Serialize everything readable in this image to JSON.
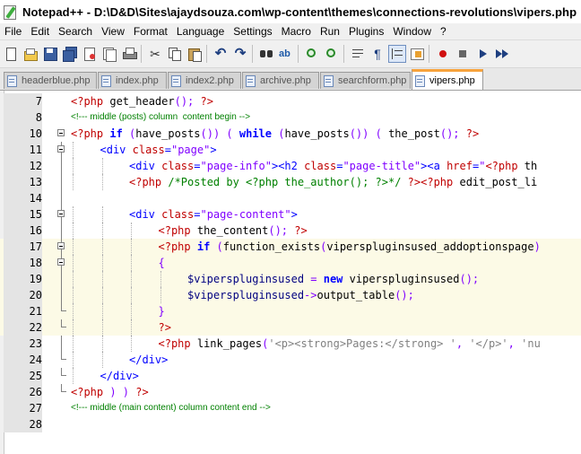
{
  "window": {
    "title": "Notepad++ - D:\\D&D\\Sites\\ajaydsouza.com\\wp-content\\themes\\connections-revolutions\\vipers.php"
  },
  "menu": [
    "File",
    "Edit",
    "Search",
    "View",
    "Format",
    "Language",
    "Settings",
    "Macro",
    "Run",
    "Plugins",
    "Window",
    "?"
  ],
  "toolbar": {
    "buttons": [
      "new-icon",
      "open-icon",
      "save-icon",
      "save-all-icon",
      "close-icon",
      "close-all-icon",
      "print-icon",
      "cut-icon",
      "copy-icon",
      "paste-icon",
      "undo-icon",
      "redo-icon",
      "find-icon",
      "replace-icon",
      "zoom-in-icon",
      "zoom-out-icon",
      "wrap-icon",
      "show-all-icon",
      "indent-guide-icon",
      "lang-icon",
      "record-icon",
      "stop-icon",
      "play-icon",
      "run-multi-icon"
    ],
    "active": "lang-icon"
  },
  "tabs": [
    {
      "label": "headerblue.php",
      "active": false
    },
    {
      "label": "index.php",
      "active": false
    },
    {
      "label": "index2.php",
      "active": false
    },
    {
      "label": "archive.php",
      "active": false
    },
    {
      "label": "searchform.php",
      "active": false
    },
    {
      "label": "vipers.php",
      "active": true
    }
  ],
  "editor": {
    "lines": [
      {
        "n": "7",
        "fold": "",
        "indent": 0,
        "hl": false,
        "tokens": [
          [
            "php",
            "<?php "
          ],
          [
            "fn",
            "get_header"
          ],
          [
            "op",
            "(); "
          ],
          [
            "php",
            "?>"
          ]
        ]
      },
      {
        "n": "8",
        "fold": "",
        "indent": 0,
        "hl": false,
        "small": true,
        "tokens": [
          [
            "com",
            "<!--- middle (posts) column  content begin -->"
          ]
        ]
      },
      {
        "n": "10",
        "fold": "box",
        "indent": 0,
        "hl": false,
        "tokens": [
          [
            "php",
            "<?php "
          ],
          [
            "kw",
            "if"
          ],
          [
            "op",
            " ("
          ],
          [
            "fn",
            "have_posts"
          ],
          [
            "op",
            "()) ( "
          ],
          [
            "kw",
            "while"
          ],
          [
            "op",
            " ("
          ],
          [
            "fn",
            "have_posts"
          ],
          [
            "op",
            "()) ( "
          ],
          [
            "fn",
            "the_post"
          ],
          [
            "op",
            "(); "
          ],
          [
            "php",
            "?>"
          ]
        ]
      },
      {
        "n": "11",
        "fold": "box",
        "indent": 1,
        "hl": false,
        "tokens": [
          [
            "tag",
            "<div "
          ],
          [
            "attr",
            "class"
          ],
          [
            "tag",
            "="
          ],
          [
            "str",
            "\"page\""
          ],
          [
            "tag",
            ">"
          ]
        ]
      },
      {
        "n": "12",
        "fold": "line",
        "indent": 2,
        "hl": false,
        "tokens": [
          [
            "tag",
            "<div "
          ],
          [
            "attr",
            "class"
          ],
          [
            "tag",
            "="
          ],
          [
            "str",
            "\"page-info\""
          ],
          [
            "tag",
            "><h2 "
          ],
          [
            "attr",
            "class"
          ],
          [
            "tag",
            "="
          ],
          [
            "str",
            "\"page-title\""
          ],
          [
            "tag",
            "><a "
          ],
          [
            "attr",
            "href"
          ],
          [
            "tag",
            "="
          ],
          [
            "str",
            "\""
          ],
          [
            "php",
            "<?php "
          ],
          [
            "fn",
            "th"
          ]
        ]
      },
      {
        "n": "13",
        "fold": "line",
        "indent": 2,
        "hl": false,
        "tokens": [
          [
            "php",
            "<?php "
          ],
          [
            "com",
            "/*Posted by <?php the_author(); ?>*/ "
          ],
          [
            "php",
            "?><?php "
          ],
          [
            "fn",
            "edit_post_li"
          ]
        ]
      },
      {
        "n": "14",
        "fold": "line",
        "indent": 0,
        "hl": false,
        "tokens": []
      },
      {
        "n": "15",
        "fold": "box",
        "indent": 2,
        "hl": false,
        "tokens": [
          [
            "tag",
            "<div "
          ],
          [
            "attr",
            "class"
          ],
          [
            "tag",
            "="
          ],
          [
            "str",
            "\"page-content\""
          ],
          [
            "tag",
            ">"
          ]
        ]
      },
      {
        "n": "16",
        "fold": "line",
        "indent": 3,
        "hl": false,
        "tokens": [
          [
            "php",
            "<?php "
          ],
          [
            "fn",
            "the_content"
          ],
          [
            "op",
            "(); "
          ],
          [
            "php",
            "?>"
          ]
        ]
      },
      {
        "n": "17",
        "fold": "box",
        "indent": 3,
        "hl": true,
        "tokens": [
          [
            "php",
            "<?php "
          ],
          [
            "kw",
            "if"
          ],
          [
            "op",
            " ("
          ],
          [
            "fn",
            "function_exists"
          ],
          [
            "op",
            "("
          ],
          [
            "fn",
            "viperspluginsused_addoptionspage"
          ],
          [
            "op",
            ")"
          ]
        ]
      },
      {
        "n": "18",
        "fold": "box",
        "indent": 3,
        "hl": true,
        "tokens": [
          [
            "op",
            "{"
          ]
        ]
      },
      {
        "n": "19",
        "fold": "line",
        "indent": 4,
        "hl": true,
        "tokens": [
          [
            "var",
            "$viperspluginsused "
          ],
          [
            "op",
            "= "
          ],
          [
            "kw",
            "new "
          ],
          [
            "fn",
            "viperspluginsused"
          ],
          [
            "op",
            "();"
          ]
        ]
      },
      {
        "n": "20",
        "fold": "line",
        "indent": 4,
        "hl": true,
        "tokens": [
          [
            "var",
            "$viperspluginsused"
          ],
          [
            "op",
            "->"
          ],
          [
            "fn",
            "output_table"
          ],
          [
            "op",
            "();"
          ]
        ]
      },
      {
        "n": "21",
        "fold": "end",
        "indent": 3,
        "hl": true,
        "tokens": [
          [
            "op",
            "}"
          ]
        ]
      },
      {
        "n": "22",
        "fold": "end",
        "indent": 3,
        "hl": true,
        "tokens": [
          [
            "php",
            "?>"
          ]
        ]
      },
      {
        "n": "23",
        "fold": "line",
        "indent": 3,
        "hl": false,
        "tokens": [
          [
            "php",
            "<?php "
          ],
          [
            "fn",
            "link_pages"
          ],
          [
            "op",
            "("
          ],
          [
            "gray",
            "'<p><strong>Pages:</strong> '"
          ],
          [
            "op",
            ", "
          ],
          [
            "gray",
            "'</p>'"
          ],
          [
            "op",
            ", "
          ],
          [
            "gray",
            "'nu"
          ]
        ]
      },
      {
        "n": "24",
        "fold": "end",
        "indent": 2,
        "hl": false,
        "tokens": [
          [
            "tag",
            "</div>"
          ]
        ]
      },
      {
        "n": "25",
        "fold": "end",
        "indent": 1,
        "hl": false,
        "tokens": [
          [
            "tag",
            "</div>"
          ]
        ]
      },
      {
        "n": "26",
        "fold": "end",
        "indent": 0,
        "hl": false,
        "tokens": [
          [
            "php",
            "<?php "
          ],
          [
            "op",
            ") ) "
          ],
          [
            "php",
            "?>"
          ]
        ]
      },
      {
        "n": "27",
        "fold": "",
        "indent": 0,
        "hl": false,
        "small": true,
        "tokens": [
          [
            "com",
            "<!--- middle (main content) column content end -->"
          ]
        ]
      },
      {
        "n": "28",
        "fold": "",
        "indent": 0,
        "hl": false,
        "tokens": []
      }
    ]
  }
}
